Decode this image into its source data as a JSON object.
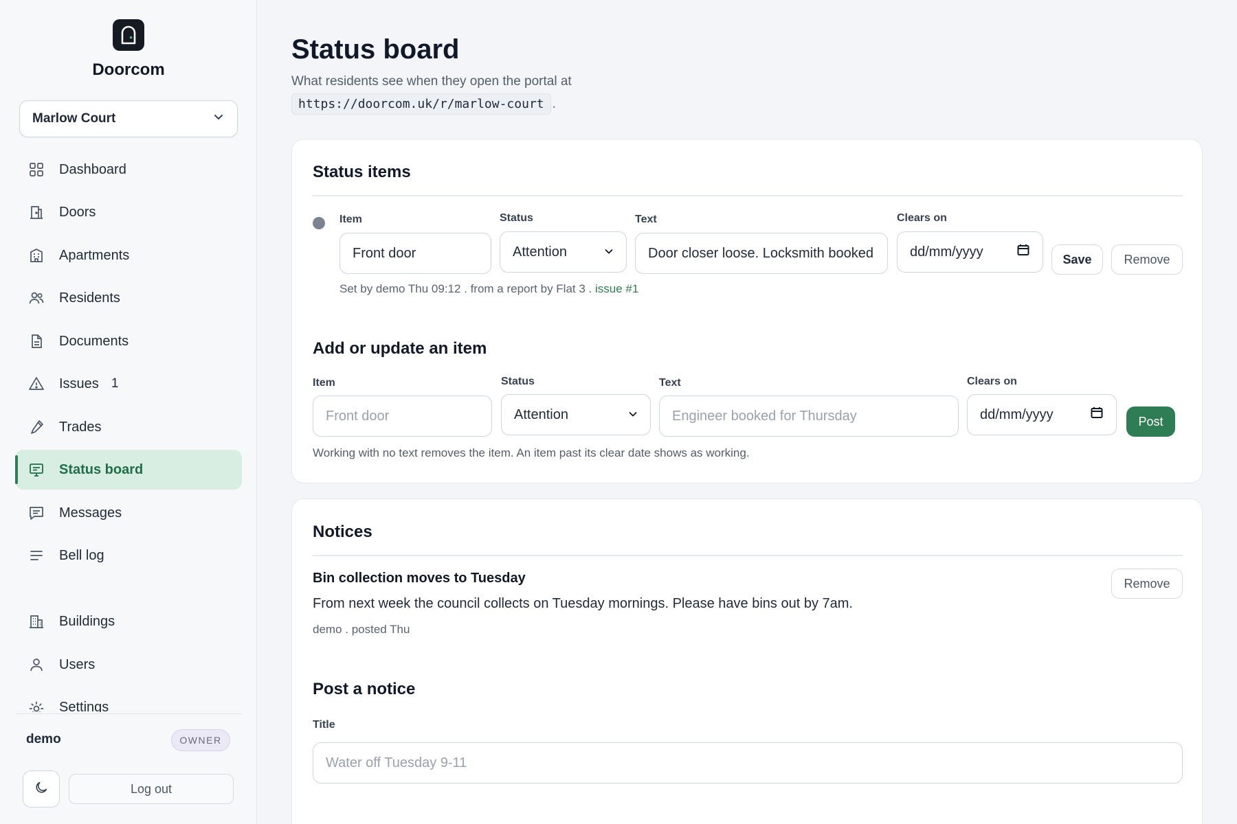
{
  "brand": {
    "name": "Doorcom"
  },
  "building_select": {
    "value": "Marlow Court"
  },
  "nav": [
    {
      "key": "dashboard",
      "label": "Dashboard",
      "icon": "grid-icon"
    },
    {
      "key": "doors",
      "label": "Doors",
      "icon": "door-icon"
    },
    {
      "key": "apartments",
      "label": "Apartments",
      "icon": "apartment-icon"
    },
    {
      "key": "residents",
      "label": "Residents",
      "icon": "residents-icon"
    },
    {
      "key": "documents",
      "label": "Documents",
      "icon": "document-icon"
    },
    {
      "key": "issues",
      "label": "Issues",
      "icon": "warning-icon",
      "count": "1"
    },
    {
      "key": "trades",
      "label": "Trades",
      "icon": "wrench-icon"
    },
    {
      "key": "status-board",
      "label": "Status board",
      "icon": "monitor-icon",
      "active": true
    },
    {
      "key": "messages",
      "label": "Messages",
      "icon": "message-icon"
    },
    {
      "key": "bell-log",
      "label": "Bell log",
      "icon": "list-icon"
    },
    {
      "key": "buildings",
      "label": "Buildings",
      "icon": "building-icon"
    },
    {
      "key": "users",
      "label": "Users",
      "icon": "user-icon"
    },
    {
      "key": "settings",
      "label": "Settings",
      "icon": "gear-icon"
    }
  ],
  "user": {
    "name": "demo",
    "role": "OWNER"
  },
  "logout_label": "Log out",
  "page": {
    "title": "Status board",
    "subtitle": "What residents see when they open the portal at",
    "url": "https://doorcom.uk/r/marlow-court",
    "url_suffix": "."
  },
  "status_items": {
    "title": "Status items",
    "labels": {
      "item": "Item",
      "status": "Status",
      "text": "Text",
      "clears_on": "Clears on"
    },
    "items": [
      {
        "item": "Front door",
        "status": "Attention",
        "text": "Door closer loose. Locksmith booked",
        "clears_on": "dd/mm/yyyy",
        "meta": "Set by demo Thu 09:12 . from a report by Flat 3 .",
        "issue_link": "issue #1"
      }
    ],
    "save_label": "Save",
    "remove_label": "Remove"
  },
  "add_item": {
    "title": "Add or update an item",
    "labels": {
      "item": "Item",
      "status": "Status",
      "text": "Text",
      "clears_on": "Clears on"
    },
    "item_placeholder": "Front door",
    "status_value": "Attention",
    "text_placeholder": "Engineer booked for Thursday",
    "clears_on": "dd/mm/yyyy",
    "post_label": "Post",
    "hint": "Working with no text removes the item. An item past its clear date shows as working."
  },
  "notices": {
    "title": "Notices",
    "items": [
      {
        "title": "Bin collection moves to Tuesday",
        "body": "From next week the council collects on Tuesday mornings. Please have bins out by 7am.",
        "meta": "demo . posted Thu"
      }
    ],
    "remove_label": "Remove"
  },
  "post_notice": {
    "title": "Post a notice",
    "title_label": "Title",
    "title_placeholder": "Water off Tuesday 9-11"
  },
  "colors": {
    "accent": "#2f7d55",
    "active_bg": "#d9eee3",
    "page_bg": "#f3f5f9"
  }
}
